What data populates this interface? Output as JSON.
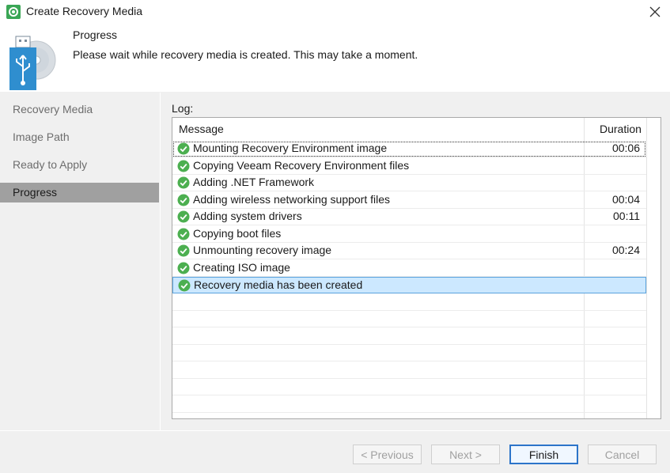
{
  "window": {
    "title": "Create Recovery Media"
  },
  "header": {
    "title": "Progress",
    "subtitle": "Please wait while recovery media is created. This may take a moment."
  },
  "sidebar": {
    "items": [
      {
        "label": "Recovery Media",
        "active": false
      },
      {
        "label": "Image Path",
        "active": false
      },
      {
        "label": "Ready to Apply",
        "active": false
      },
      {
        "label": "Progress",
        "active": true
      }
    ]
  },
  "log": {
    "label": "Log:",
    "columns": {
      "message": "Message",
      "duration": "Duration"
    },
    "rows": [
      {
        "message": "Mounting Recovery Environment image",
        "duration": "00:06",
        "status": "success"
      },
      {
        "message": "Copying Veeam Recovery Environment files",
        "duration": "",
        "status": "success"
      },
      {
        "message": "Adding .NET Framework",
        "duration": "",
        "status": "success"
      },
      {
        "message": "Adding wireless networking support files",
        "duration": "00:04",
        "status": "success"
      },
      {
        "message": "Adding system drivers",
        "duration": "00:11",
        "status": "success"
      },
      {
        "message": "Copying boot files",
        "duration": "",
        "status": "success"
      },
      {
        "message": "Unmounting recovery image",
        "duration": "00:24",
        "status": "success"
      },
      {
        "message": "Creating ISO image",
        "duration": "",
        "status": "success"
      },
      {
        "message": "Recovery media has been created",
        "duration": "",
        "status": "success"
      }
    ]
  },
  "buttons": {
    "previous": "< Previous",
    "next": "Next >",
    "finish": "Finish",
    "cancel": "Cancel"
  },
  "colors": {
    "accent": "#2c74c9",
    "success": "#4caf50",
    "selected_row": "#cce8ff",
    "active_sidebar": "#a0a0a0"
  }
}
